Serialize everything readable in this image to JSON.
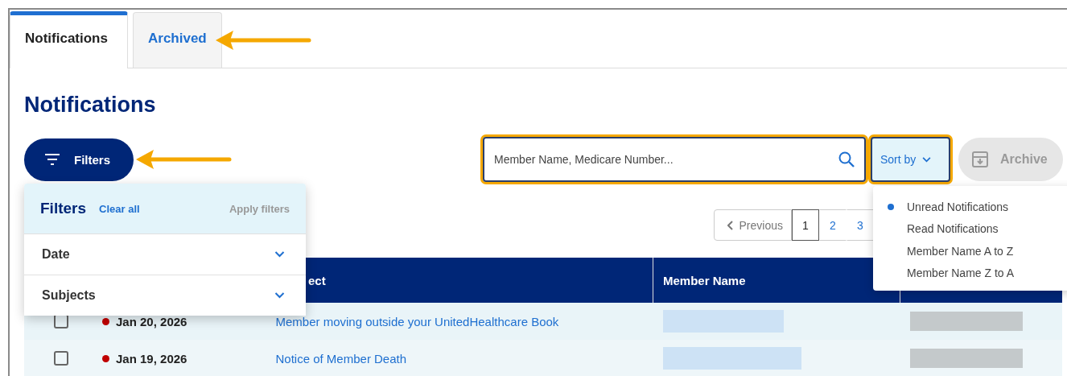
{
  "tabs": [
    {
      "label": "Notifications",
      "selected": true
    },
    {
      "label": "Archived",
      "selected": false
    }
  ],
  "heading": "Notifications",
  "filters_button": {
    "label": "Filters"
  },
  "search": {
    "placeholder": "Member Name, Medicare Number..."
  },
  "sort_button": {
    "label": "Sort by"
  },
  "archive_button": {
    "label": "Archive",
    "disabled": true
  },
  "filter_panel": {
    "title": "Filters",
    "clear": "Clear all",
    "apply": "Apply filters",
    "sections": [
      {
        "label": "Date",
        "expanded": false
      },
      {
        "label": "Subjects",
        "expanded": false
      }
    ]
  },
  "pagination": {
    "previous": "Previous",
    "pages": [
      {
        "label": "1",
        "selected": true
      },
      {
        "label": "2",
        "selected": false
      },
      {
        "label": "3",
        "selected": false
      }
    ]
  },
  "sort_menu": [
    {
      "label": "Unread Notifications",
      "selected": true
    },
    {
      "label": "Read Notifications",
      "selected": false
    },
    {
      "label": "Member Name A to Z",
      "selected": false
    },
    {
      "label": "Member Name Z to A",
      "selected": false
    }
  ],
  "table": {
    "columns": [
      "ect",
      "Member Name"
    ],
    "rows": [
      {
        "checked": false,
        "unread": true,
        "date": "Jan 20, 2026",
        "subject": "Member moving outside your UnitedHealthcare Book"
      },
      {
        "checked": false,
        "unread": true,
        "date": "Jan 19, 2026",
        "subject": "Notice of Member Death"
      }
    ]
  }
}
